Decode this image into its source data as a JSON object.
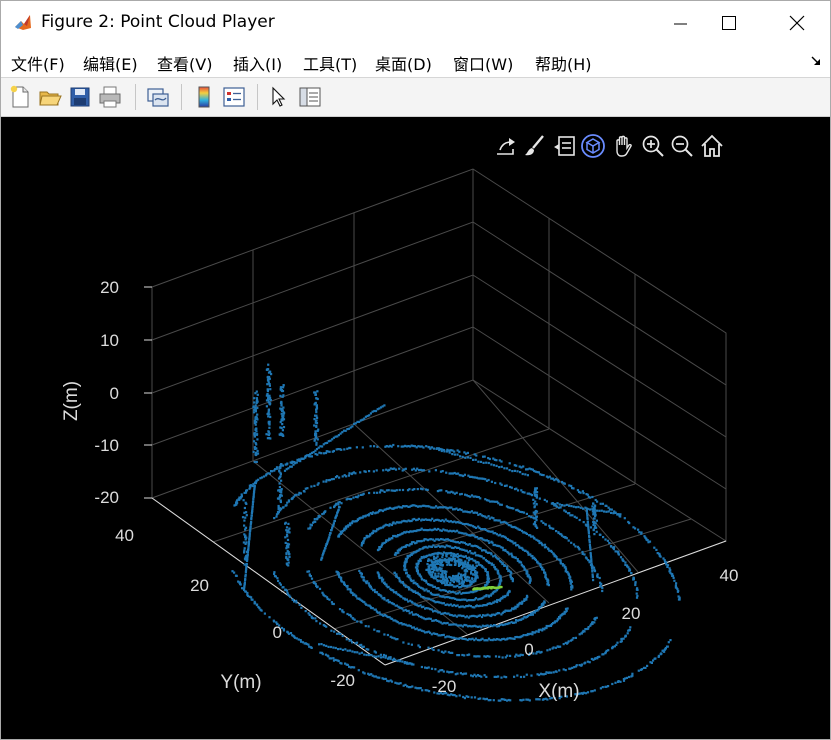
{
  "window": {
    "title": "Figure 2: Point Cloud Player"
  },
  "menu": {
    "items": [
      "文件(F)",
      "编辑(E)",
      "查看(V)",
      "插入(I)",
      "工具(T)",
      "桌面(D)",
      "窗口(W)",
      "帮助(H)"
    ]
  },
  "toolbar": {
    "icons": [
      "new-figure-icon",
      "open-file-icon",
      "save-icon",
      "print-icon",
      "link-plot-icon",
      "colorbar-icon",
      "legend-icon",
      "edit-plot-arrow-icon",
      "property-inspector-icon"
    ]
  },
  "axes_toolbar": {
    "icons": [
      "export-icon",
      "brush-icon",
      "data-tips-icon",
      "rotate-3d-icon",
      "pan-icon",
      "zoom-in-icon",
      "zoom-out-icon",
      "home-icon"
    ],
    "active": "rotate-3d-icon"
  },
  "colors": {
    "figure_bg": "#000000",
    "points": "#1f77b4",
    "highlight_points": "#7fd03a",
    "grid": "#4a4a4a",
    "tick_text": "#dcdcdc",
    "active_tool": "#6a8cff"
  },
  "chart_data": {
    "type": "scatter",
    "projection": "3d",
    "xlabel": "X(m)",
    "ylabel": "Y(m)",
    "zlabel": "Z(m)",
    "x_ticks": [
      "-20",
      "0",
      "20",
      "40"
    ],
    "y_ticks": [
      "-20",
      "0",
      "20",
      "40"
    ],
    "z_ticks": [
      "-20",
      "-10",
      "0",
      "10",
      "20"
    ],
    "xlim": [
      -20,
      45
    ],
    "ylim": [
      -25,
      45
    ],
    "zlim": [
      -20,
      20
    ],
    "grid": true,
    "series": [
      {
        "rings": [
          4,
          6,
          8,
          10,
          13,
          16,
          20,
          25,
          31,
          38
        ]
      }
    ]
  }
}
